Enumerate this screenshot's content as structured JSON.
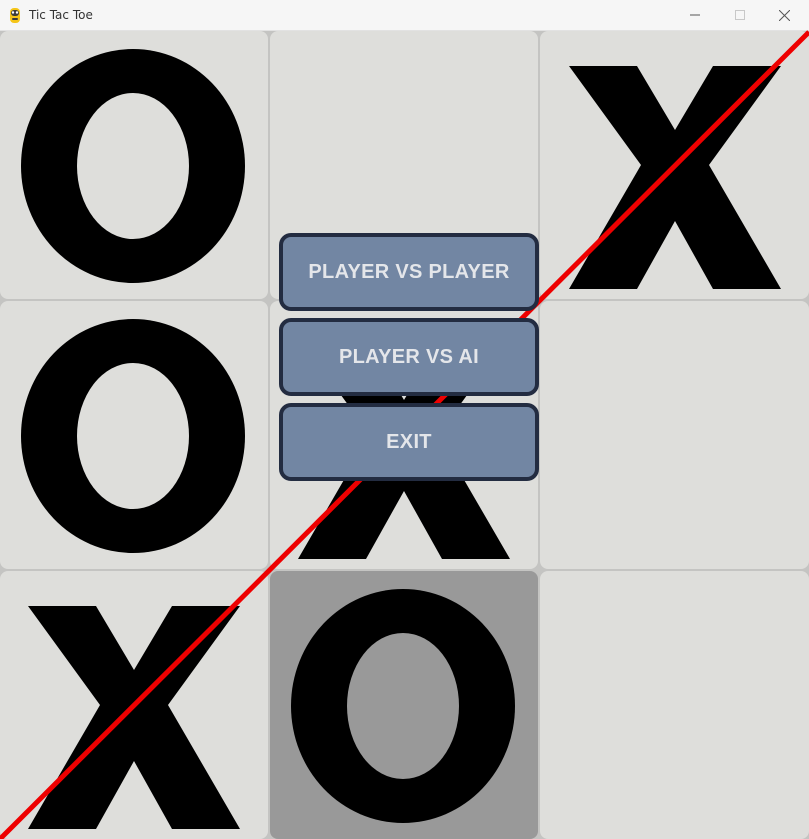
{
  "window": {
    "title": "Tic Tac Toe",
    "controls": [
      "minimize",
      "maximize",
      "close"
    ]
  },
  "board": {
    "cells": [
      {
        "row": 0,
        "col": 0,
        "mark": "O",
        "highlighted": false
      },
      {
        "row": 0,
        "col": 1,
        "mark": "",
        "highlighted": false
      },
      {
        "row": 0,
        "col": 2,
        "mark": "X",
        "highlighted": false
      },
      {
        "row": 1,
        "col": 0,
        "mark": "O",
        "highlighted": false
      },
      {
        "row": 1,
        "col": 1,
        "mark": "X",
        "highlighted": false
      },
      {
        "row": 1,
        "col": 2,
        "mark": "",
        "highlighted": false
      },
      {
        "row": 2,
        "col": 0,
        "mark": "X",
        "highlighted": false
      },
      {
        "row": 2,
        "col": 1,
        "mark": "O",
        "highlighted": true
      },
      {
        "row": 2,
        "col": 2,
        "mark": "",
        "highlighted": false
      }
    ],
    "winning_line": "anti-diagonal",
    "colors": {
      "cell": "#dededb",
      "highlighted_cell": "#999999",
      "mark": "#000000",
      "win_line": "#ee0000",
      "grid_gap": "#c4c4c2"
    }
  },
  "menu": {
    "buttons": [
      {
        "id": "pvp",
        "label": "PLAYER VS PLAYER"
      },
      {
        "id": "pvai",
        "label": "PLAYER VS AI"
      },
      {
        "id": "exit",
        "label": "EXIT"
      }
    ],
    "colors": {
      "fill": "#7286a3",
      "border": "#232c41",
      "text": "#e4e6ea"
    }
  }
}
